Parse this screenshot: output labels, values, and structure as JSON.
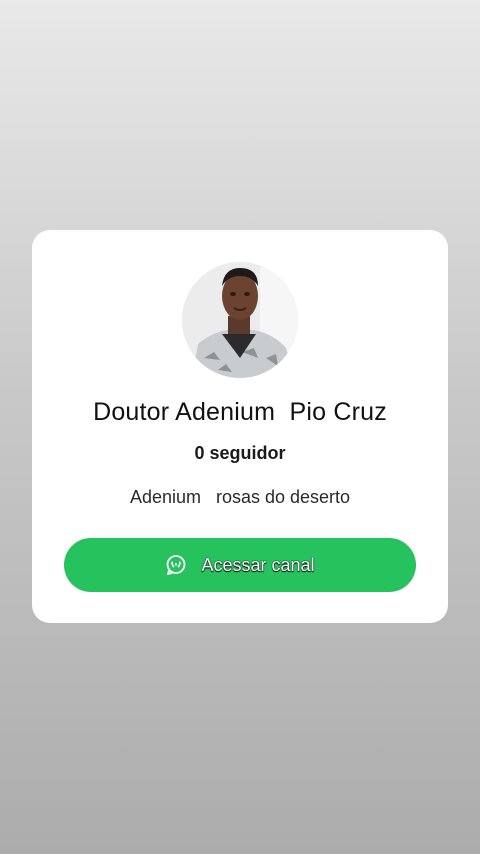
{
  "channel": {
    "name": "Doutor Adenium  Pio Cruz",
    "followers": "0 seguidor",
    "description": "Adenium   rosas do deserto",
    "avatar_icon": "profile-photo"
  },
  "action": {
    "label": "Acessar canal",
    "icon": "whatsapp-icon",
    "color": "#25c25e"
  }
}
